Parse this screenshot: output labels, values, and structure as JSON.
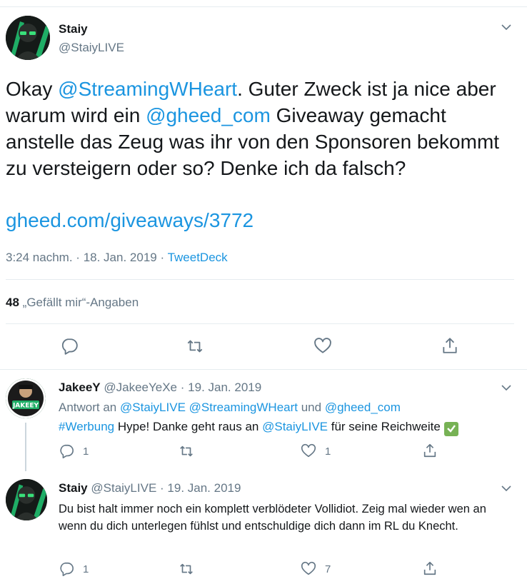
{
  "main_tweet": {
    "name": "Staiy",
    "handle": "@StaiyLIVE",
    "text_parts": [
      "Okay ",
      "@StreamingWHeart",
      ". Guter Zweck ist ja nice aber warum wird ein ",
      "@gheed_com",
      " Giveaway gemacht anstelle das Zeug was ihr von den Sponsoren bekommt zu versteigern oder so? Denke ich da falsch?"
    ],
    "url": "gheed.com/giveaways/3772",
    "time": "3:24 nachm.",
    "sep": "·",
    "date": "18. Jan. 2019",
    "source": "TweetDeck",
    "likes_count": "48",
    "likes_label": "„Gefällt mir“-Angaben"
  },
  "replies": [
    {
      "name": "JakeeY",
      "handle": "@JakeeYeXe",
      "sep": "·",
      "date": "19. Jan. 2019",
      "reply_to_prefix": "Antwort an ",
      "reply_to_1": "@StaiyLIVE",
      "reply_to_2": "@StreamingWHeart",
      "reply_to_and": " und ",
      "reply_to_3": "@gheed_com",
      "hashtag": "#Werbung",
      "text_1": " Hype! Danke geht raus an ",
      "mention": "@StaiyLIVE",
      "text_2": " für seine Reichweite ",
      "emoji": "✅",
      "reply_count": "1",
      "like_count": "1"
    },
    {
      "name": "Staiy",
      "handle": "@StaiyLIVE",
      "sep": "·",
      "date": "19. Jan. 2019",
      "text": "Du bist halt immer noch ein komplett verblödeter Vollidiot. Zeig mal wieder wen an wenn du dich unterlegen fühlst und entschuldige dich dann im RL du Knecht.",
      "reply_count": "1",
      "like_count": "7"
    }
  ],
  "avatar_badge": "JAKEEY",
  "colors": {
    "link": "#1b95e0",
    "muted": "#657786",
    "text": "#14171a",
    "divider": "#e6ecf0",
    "check_green": "#77b255"
  }
}
